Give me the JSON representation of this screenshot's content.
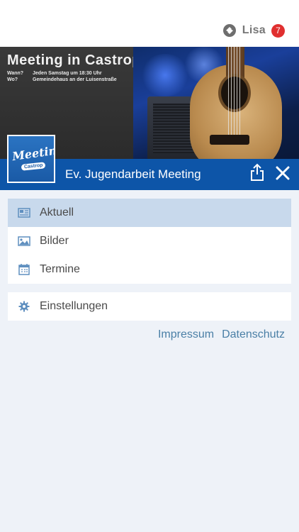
{
  "user": {
    "name": "Lisa",
    "badge_count": "7",
    "icon": "user-switch-icon"
  },
  "banner": {
    "title": "Meeting in Castrop",
    "rows": [
      {
        "key": "Wann?",
        "value": "Jeden Samstag um 18:30 Uhr"
      },
      {
        "key": "Wo?",
        "value": "Gemeindehaus an der Luisenstraße"
      }
    ]
  },
  "logo": {
    "word": "Meeting",
    "sub": "Castrop"
  },
  "header": {
    "title": "Ev. Jugendarbeit Meeting",
    "color": "#0d55a8"
  },
  "menu": {
    "items": [
      {
        "label": "Aktuell",
        "icon": "newspaper-icon",
        "active": true
      },
      {
        "label": "Bilder",
        "icon": "image-icon",
        "active": false
      },
      {
        "label": "Termine",
        "icon": "calendar-icon",
        "active": false
      }
    ],
    "settings": {
      "label": "Einstellungen",
      "icon": "gear-icon"
    }
  },
  "links": {
    "impressum": "Impressum",
    "datenschutz": "Datenschutz"
  },
  "colors": {
    "accent": "#0d55a8",
    "badge": "#e02f2f",
    "active_row": "#c8d9ec",
    "background": "#eef2f8",
    "link": "#4a7fa6"
  }
}
